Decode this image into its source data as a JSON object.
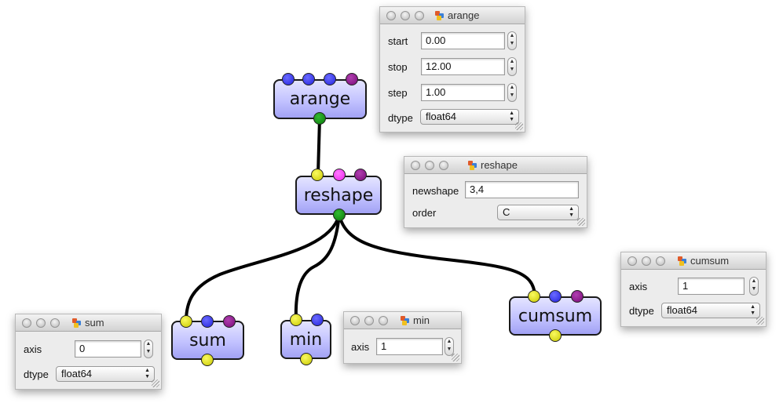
{
  "nodes": {
    "arange": {
      "label": "arange"
    },
    "reshape": {
      "label": "reshape"
    },
    "sum": {
      "label": "sum"
    },
    "min": {
      "label": "min"
    },
    "cumsum": {
      "label": "cumsum"
    }
  },
  "port_colors": {
    "blue": "#2a2ae0",
    "purple": "#7f0f7f",
    "yellow": "#d8d800",
    "magenta": "#f030f0",
    "green": "#0a8a0a"
  },
  "windows": {
    "arange": {
      "title": "arange",
      "start_label": "start",
      "start_value": "0.00",
      "stop_label": "stop",
      "stop_value": "12.00",
      "step_label": "step",
      "step_value": "1.00",
      "dtype_label": "dtype",
      "dtype_value": "float64"
    },
    "reshape": {
      "title": "reshape",
      "newshape_label": "newshape",
      "newshape_value": "3,4",
      "order_label": "order",
      "order_value": "C"
    },
    "cumsum": {
      "title": "cumsum",
      "axis_label": "axis",
      "axis_value": "1",
      "dtype_label": "dtype",
      "dtype_value": "float64"
    },
    "sum": {
      "title": "sum",
      "axis_label": "axis",
      "axis_value": "0",
      "dtype_label": "dtype",
      "dtype_value": "float64"
    },
    "min": {
      "title": "min",
      "axis_label": "axis",
      "axis_value": "1"
    }
  }
}
